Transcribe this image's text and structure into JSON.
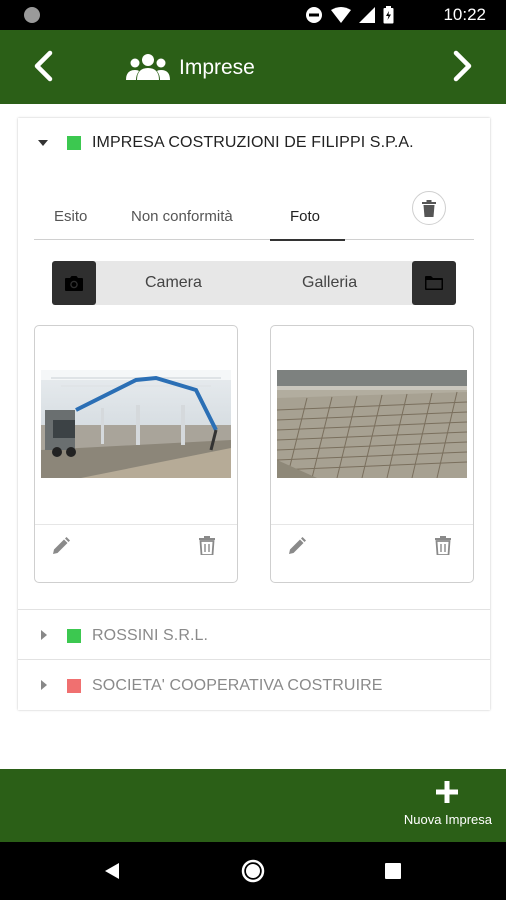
{
  "status_bar": {
    "time": "10:22",
    "icons": [
      "camera-dot-icon",
      "dnd-icon",
      "wifi-icon",
      "signal-icon",
      "battery-icon"
    ]
  },
  "header": {
    "title": "Imprese",
    "icon": "people-icon",
    "back_icon": "chevron-left-icon",
    "forward_icon": "chevron-right-icon",
    "background": "#2b5f17"
  },
  "companies": [
    {
      "name": "IMPRESA COSTRUZIONI DE FILIPPI S.P.A.",
      "status_color": "#3cc850",
      "expanded": true
    },
    {
      "name": "ROSSINI S.R.L.",
      "status_color": "#3cc850",
      "expanded": false
    },
    {
      "name": "SOCIETA' COOPERATIVA COSTRUIRE",
      "status_color": "#f07070",
      "expanded": false
    }
  ],
  "tabs": [
    {
      "label": "Esito"
    },
    {
      "label": "Non conformità"
    },
    {
      "label": "Foto",
      "active": true
    }
  ],
  "source_selector": {
    "camera_label": "Camera",
    "gallery_label": "Galleria",
    "camera_icon": "camera-icon",
    "gallery_icon": "folder-icon"
  },
  "photos": [
    {
      "subject": "concrete-pump-warehouse",
      "edit_icon": "pencil-icon",
      "delete_icon": "trash-icon"
    },
    {
      "subject": "rebar-mesh-floor",
      "edit_icon": "pencil-icon",
      "delete_icon": "trash-icon"
    }
  ],
  "bottom_bar": {
    "action_label": "Nuova Impresa",
    "action_icon": "plus-icon"
  },
  "nav_bar": {
    "icons": [
      "back-triangle-icon",
      "home-circle-icon",
      "recents-square-icon"
    ]
  }
}
